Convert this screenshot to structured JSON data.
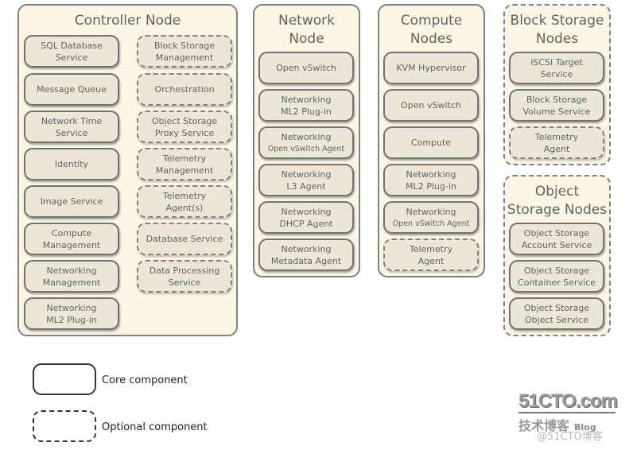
{
  "nodes": {
    "controller": {
      "title": "Controller Node",
      "core": [
        "SQL Database\nService",
        "Message Queue",
        "Network Time\nService",
        "Identity",
        "Image Service",
        "Compute\nManagement",
        "Networking\nManagement",
        "Networking\nML2 Plug-in"
      ],
      "optional": [
        "Block Storage\nManagement",
        "Orchestration",
        "Object Storage\nProxy Service",
        "Telemetry\nManagement",
        "Telemetry\nAgent(s)",
        "Database Service",
        "Data Processing\nService"
      ]
    },
    "network": {
      "title": "Network\nNode",
      "core": [
        "Open vSwitch",
        "Networking\nML2 Plug-in",
        "Networking",
        "Networking\nL3 Agent",
        "Networking\nDHCP Agent",
        "Networking\nMetadata Agent"
      ],
      "core_sub": [
        "",
        "",
        "Open vSwitch Agent",
        "",
        "",
        ""
      ]
    },
    "compute": {
      "title": "Compute\nNodes",
      "core": [
        "KVM Hypervisor",
        "Open vSwitch",
        "Compute",
        "Networking\nML2 Plug-in",
        "Networking"
      ],
      "core_sub": [
        "",
        "",
        "",
        "",
        "Open vSwitch Agent"
      ],
      "optional": [
        "Telemetry\nAgent"
      ]
    },
    "block_storage": {
      "title": "Block Storage\nNodes",
      "core": [
        "iSCSI Target\nService",
        "Block Storage\nVolume Service"
      ],
      "optional": [
        "Telemetry\nAgent"
      ]
    },
    "object_storage": {
      "title": "Object\nStorage Nodes",
      "core": [
        "Object Storage\nAccount Service",
        "Object Storage\nContainer Service",
        "Object Storage\nObject Service"
      ]
    }
  },
  "legend": {
    "core_label": "Core component",
    "optional_label": "Optional component"
  },
  "watermark": {
    "site": "51CTO.com",
    "subtitle": "技术博客",
    "blog": "Blog",
    "handle": "@51CTO博客"
  }
}
